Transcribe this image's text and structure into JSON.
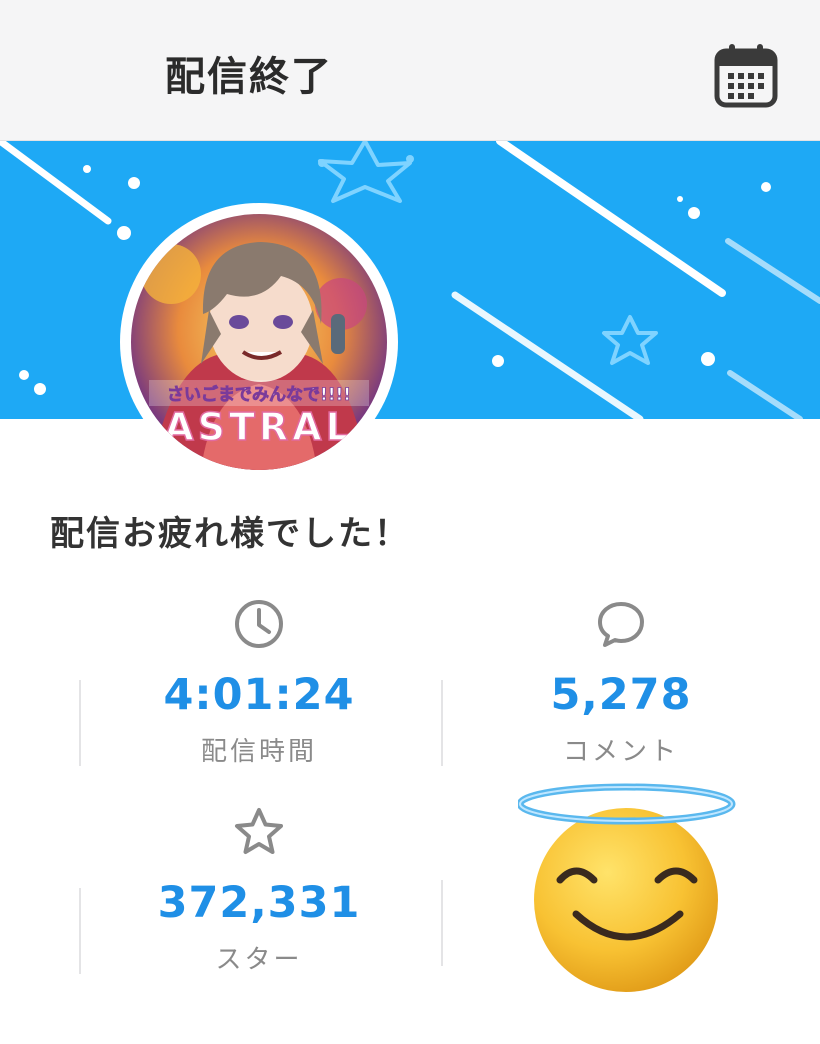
{
  "header": {
    "title": "配信終了",
    "calendar_icon": "calendar-icon"
  },
  "banner": {
    "background_color": "#1ea9f5",
    "decorations": [
      "star-icon",
      "shooting-star-lines",
      "dots"
    ]
  },
  "profile": {
    "avatar_caption_line1": "さいごまでみんなで!!!!",
    "avatar_caption_line2": "ASTRAL"
  },
  "message": "配信お疲れ様でした！",
  "stats": [
    {
      "icon": "clock-icon",
      "value": "4:01:24",
      "label": "配信時間"
    },
    {
      "icon": "comment-icon",
      "value": "5,278",
      "label": "コメント"
    },
    {
      "icon": "star-icon",
      "value": "372,331",
      "label": "スター"
    }
  ],
  "sticker": {
    "icon": "smiling-face-with-halo-emoji"
  },
  "colors": {
    "accent_blue": "#1f8fe6",
    "banner_blue": "#1ea9f5",
    "label_gray": "#8a8a8a"
  }
}
